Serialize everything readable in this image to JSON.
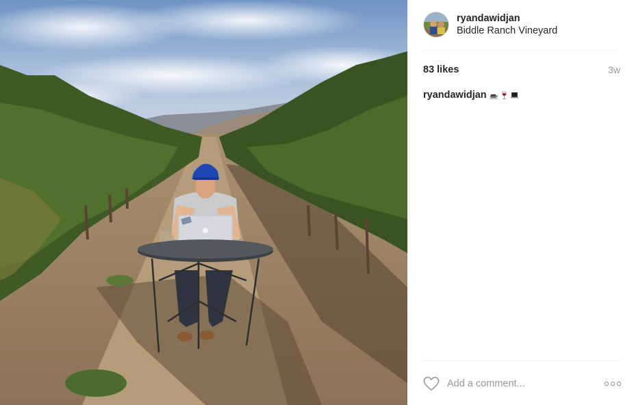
{
  "post": {
    "username": "ryandawidjan",
    "location": "Biddle Ranch Vineyard",
    "likes": "83 likes",
    "age": "3w",
    "caption": {
      "username": "ryandawidjan",
      "emojis": [
        "coffee-icon",
        "wine-glass-icon",
        "laptop-icon"
      ]
    }
  },
  "comment": {
    "placeholder": "Add a comment..."
  },
  "colors": {
    "text": "#262626",
    "muted": "#999999",
    "divider": "#efefef"
  }
}
